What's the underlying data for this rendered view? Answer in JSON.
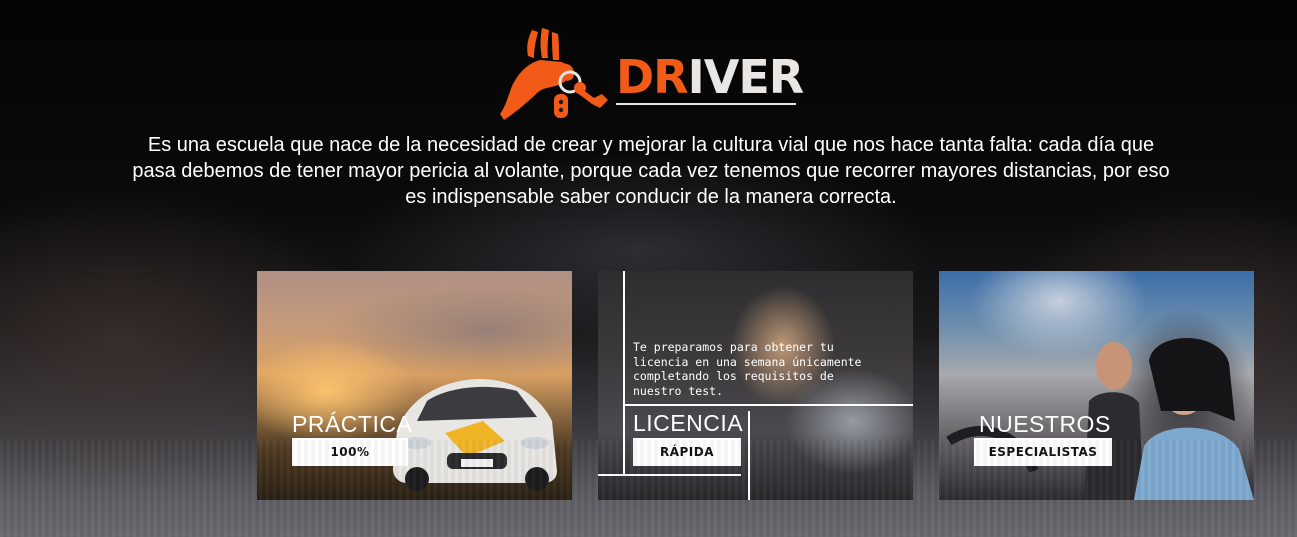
{
  "brand": {
    "name_accent": "DR",
    "name_rest": "IVER",
    "accent_color": "#f15a17",
    "text_color": "#e9e6e4"
  },
  "intro": {
    "text": "Es una escuela que nace de la necesidad de crear y mejorar la cultura vial que nos hace tanta falta: cada día que pasa debemos de tener mayor pericia al volante, porque cada vez tenemos que recorrer mayores distancias, por eso es indispensable saber conducir de la manera correcta."
  },
  "cards": [
    {
      "title": "PRÁCTICA",
      "subtitle": "100%"
    },
    {
      "description": "Te preparamos para obtener tu licencia en una semana únicamente completando los requisitos de nuestro test.",
      "title": "LICENCIA",
      "subtitle": "RÁPIDA"
    },
    {
      "title": "NUESTROS",
      "subtitle": "ESPECIALISTAS"
    }
  ]
}
